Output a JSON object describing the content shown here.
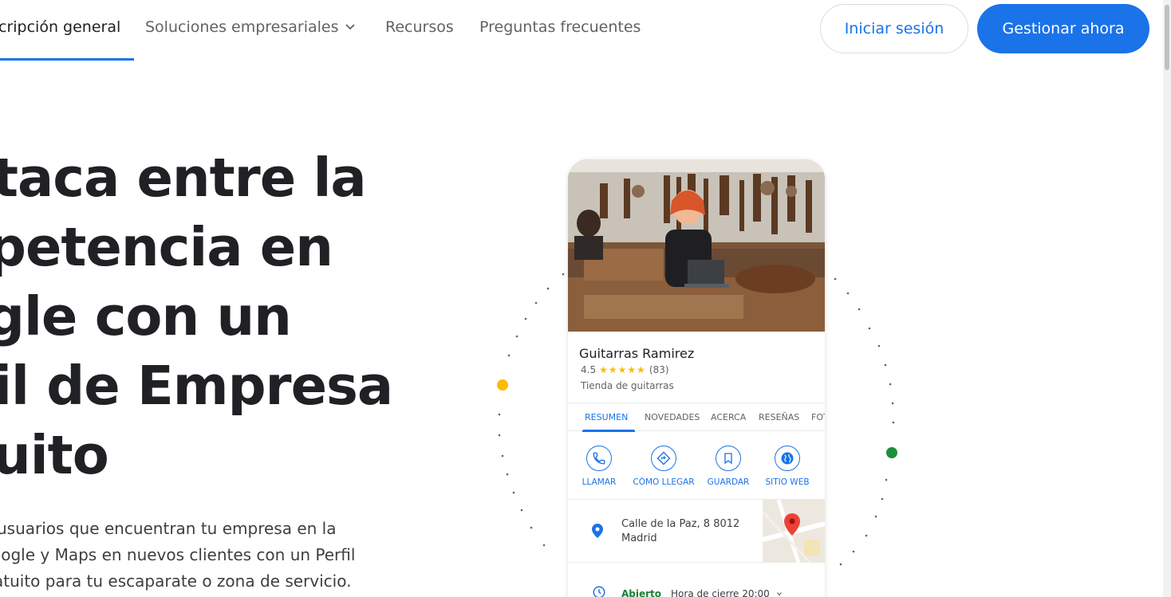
{
  "nav": {
    "items": [
      {
        "label": "cripción general",
        "active": true
      },
      {
        "label": "Soluciones empresariales",
        "active": false
      },
      {
        "label": "Recursos",
        "active": false
      },
      {
        "label": "Preguntas frecuentes",
        "active": false
      }
    ],
    "signin_label": "Iniciar sesión",
    "manage_label": "Gestionar ahora"
  },
  "hero": {
    "title_lines": [
      "taca entre la",
      "petencia en",
      "gle con un",
      "il de Empresa",
      "uito"
    ],
    "subtitle_lines": [
      "usuarios que encuentran tu empresa en la",
      "oogle y Maps en nuevos clientes con un Perfil",
      "atuito para tu escaparate o zona de servicio."
    ]
  },
  "card": {
    "business_name": "Guitarras Ramirez",
    "rating": "4.5",
    "stars": "★★★★★",
    "review_count": "(83)",
    "category": "Tienda de guitarras",
    "tabs": [
      {
        "label": "RESUMEN",
        "active": true
      },
      {
        "label": "NOVEDADES",
        "active": false
      },
      {
        "label": "ACERCA",
        "active": false
      },
      {
        "label": "RESEÑAS",
        "active": false
      },
      {
        "label": "FOT",
        "active": false
      }
    ],
    "actions": [
      {
        "label": "LLAMAR",
        "icon": "phone-icon"
      },
      {
        "label": "CÓMO LLEGAR",
        "icon": "directions-icon"
      },
      {
        "label": "GUARDAR",
        "icon": "bookmark-icon"
      },
      {
        "label": "SITIO WEB",
        "icon": "globe-icon"
      }
    ],
    "address_line1": "Calle de la Paz, 8 8012",
    "address_line2": "Madrid",
    "hours_status": "Abierto",
    "hours_close": "Hora de cierre 20:00"
  },
  "colors": {
    "accent": "#1a73e8",
    "yellow_dot": "#fbbc04",
    "green_dot": "#1e8e3e",
    "open_green": "#188038",
    "map_pin": "#ea4335"
  }
}
